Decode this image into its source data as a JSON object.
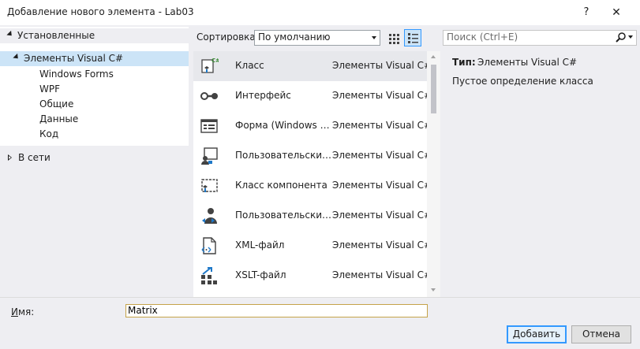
{
  "window": {
    "title": "Добавление нового элемента  - Lab03",
    "help_label": "?",
    "close_label": "✕"
  },
  "tree": {
    "installed": "Установленные",
    "visual_cs": "Элементы Visual C#",
    "children": [
      "Windows Forms",
      "WPF",
      "Общие",
      "Данные",
      "Код"
    ],
    "online": "В сети"
  },
  "toolbar": {
    "sort_label": "Сортировка:",
    "sort_value": "По умолчанию",
    "search_placeholder": "Поиск (Ctrl+E)"
  },
  "items": [
    {
      "name": "Класс",
      "type": "Элементы Visual C#",
      "icon": "class-icon"
    },
    {
      "name": "Интерфейс",
      "type": "Элементы Visual C#",
      "icon": "interface-icon"
    },
    {
      "name": "Форма (Windows Forms)",
      "type": "Элементы Visual C#",
      "icon": "form-icon"
    },
    {
      "name": "Пользовательский элемент управления",
      "type": "Элементы Visual C#",
      "icon": "user-control-icon"
    },
    {
      "name": "Класс компонента",
      "type": "Элементы Visual C#",
      "icon": "component-class-icon"
    },
    {
      "name": "Пользовательский элемент управления WPF",
      "type": "Элементы Visual C#",
      "icon": "wpf-user-control-icon"
    },
    {
      "name": "XML-файл",
      "type": "Элементы Visual C#",
      "icon": "xml-file-icon"
    },
    {
      "name": "XSLT-файл",
      "type": "Элементы Visual C#",
      "icon": "xslt-file-icon"
    }
  ],
  "detail": {
    "type_label": "Тип:",
    "type_value": "Элементы Visual C#",
    "description": "Пустое определение класса"
  },
  "bottom": {
    "name_label_prefix": "И",
    "name_label_rest": "мя:",
    "name_value": "Matrix",
    "add_label_prefix": "Д",
    "add_label_rest": "обавить",
    "cancel_label": "Отмена"
  },
  "colors": {
    "selection": "#cce4f7",
    "accent": "#3399ff",
    "icon_blue": "#1e78c8",
    "icon_dark": "#424242",
    "csharp_green": "#388a34"
  }
}
